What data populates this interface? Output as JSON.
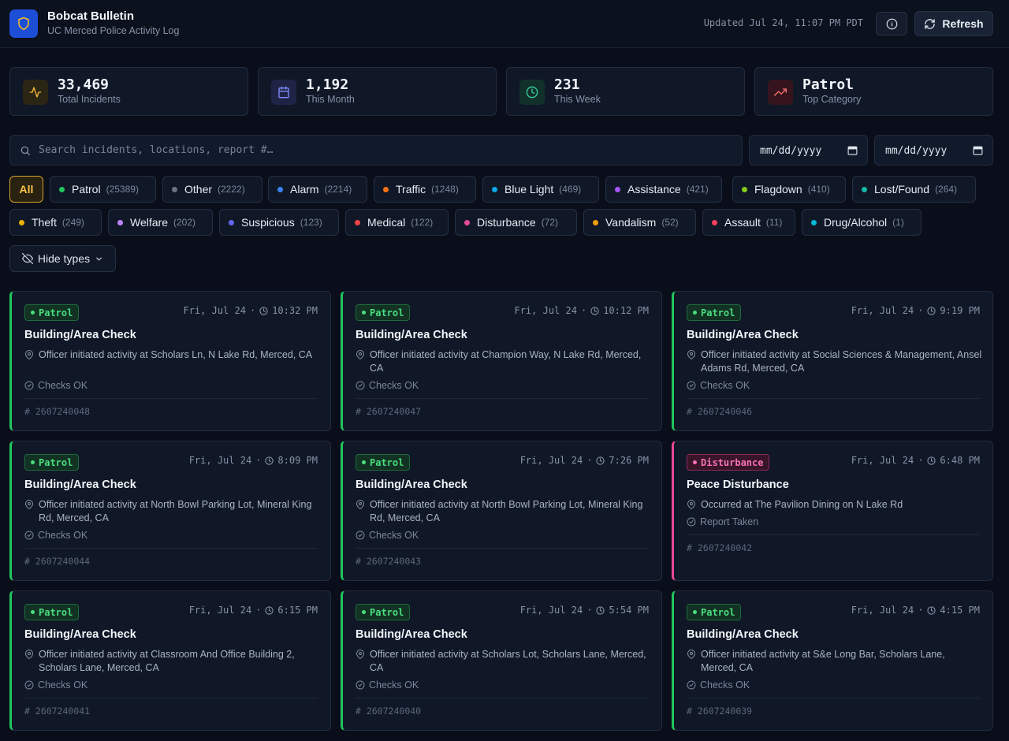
{
  "header": {
    "title": "Bobcat Bulletin",
    "subtitle": "UC Merced Police Activity Log",
    "updated": "Updated Jul 24, 11:07 PM PDT",
    "refresh_label": "Refresh"
  },
  "stats": [
    {
      "value": "33,469",
      "label": "Total Incidents",
      "icon": "activity-icon"
    },
    {
      "value": "1,192",
      "label": "This Month",
      "icon": "calendar-icon"
    },
    {
      "value": "231",
      "label": "This Week",
      "icon": "clock-icon"
    },
    {
      "value": "Patrol",
      "label": "Top Category",
      "icon": "trending-up-icon"
    }
  ],
  "search": {
    "placeholder": "Search incidents, locations, report #…"
  },
  "date_from": "mm/dd/yyyy",
  "date_to": "mm/dd/yyyy",
  "filters": {
    "all_label": "All",
    "chips": [
      {
        "label": "Patrol",
        "count": "(25389)",
        "color": "#22c55e"
      },
      {
        "label": "Other",
        "count": "(2222)",
        "color": "#6b7280"
      },
      {
        "label": "Alarm",
        "count": "(2214)",
        "color": "#3b82f6"
      },
      {
        "label": "Traffic",
        "count": "(1248)",
        "color": "#f97316"
      },
      {
        "label": "Blue Light",
        "count": "(469)",
        "color": "#0ea5e9"
      },
      {
        "label": "Assistance",
        "count": "(421)",
        "color": "#a855f7"
      },
      {
        "label": "Flagdown",
        "count": "(410)",
        "color": "#84cc16"
      },
      {
        "label": "Lost/Found",
        "count": "(264)",
        "color": "#14b8a6"
      },
      {
        "label": "Theft",
        "count": "(249)",
        "color": "#eab308"
      },
      {
        "label": "Welfare",
        "count": "(202)",
        "color": "#c084fc"
      },
      {
        "label": "Suspicious",
        "count": "(123)",
        "color": "#6366f1"
      },
      {
        "label": "Medical",
        "count": "(122)",
        "color": "#ef4444"
      },
      {
        "label": "Disturbance",
        "count": "(72)",
        "color": "#ec4899"
      },
      {
        "label": "Vandalism",
        "count": "(52)",
        "color": "#f59e0b"
      },
      {
        "label": "Assault",
        "count": "(11)",
        "color": "#f43f5e"
      },
      {
        "label": "Drug/Alcohol",
        "count": "(1)",
        "color": "#06b6d4"
      }
    ],
    "hide_label": "Hide types"
  },
  "incidents": [
    {
      "category": "Patrol",
      "date": "Fri, Jul 24",
      "time": "10:32 PM",
      "title": "Building/Area Check",
      "location": "Officer initiated activity at Scholars Ln, N Lake Rd, Merced, CA",
      "status": "Checks OK",
      "number": "2607240048"
    },
    {
      "category": "Patrol",
      "date": "Fri, Jul 24",
      "time": "10:12 PM",
      "title": "Building/Area Check",
      "location": "Officer initiated activity at Champion Way, N Lake Rd, Merced, CA",
      "status": "Checks OK",
      "number": "2607240047"
    },
    {
      "category": "Patrol",
      "date": "Fri, Jul 24",
      "time": "9:19 PM",
      "title": "Building/Area Check",
      "location": "Officer initiated activity at Social Sciences & Management, Ansel Adams Rd, Merced, CA",
      "status": "Checks OK",
      "number": "2607240046"
    },
    {
      "category": "Patrol",
      "date": "Fri, Jul 24",
      "time": "8:09 PM",
      "title": "Building/Area Check",
      "location": "Officer initiated activity at North Bowl Parking Lot, Mineral King Rd, Merced, CA",
      "status": "Checks OK",
      "number": "2607240044"
    },
    {
      "category": "Patrol",
      "date": "Fri, Jul 24",
      "time": "7:26 PM",
      "title": "Building/Area Check",
      "location": "Officer initiated activity at North Bowl Parking Lot, Mineral King Rd, Merced, CA",
      "status": "Checks OK",
      "number": "2607240043"
    },
    {
      "category": "Disturbance",
      "date": "Fri, Jul 24",
      "time": "6:48 PM",
      "title": "Peace Disturbance",
      "location": "Occurred at The Pavilion Dining on N Lake Rd",
      "status": "Report Taken",
      "number": "2607240042"
    },
    {
      "category": "Patrol",
      "date": "Fri, Jul 24",
      "time": "6:15 PM",
      "title": "Building/Area Check",
      "location": "Officer initiated activity at Classroom And Office Building 2, Scholars Lane, Merced, CA",
      "status": "Checks OK",
      "number": "2607240041"
    },
    {
      "category": "Patrol",
      "date": "Fri, Jul 24",
      "time": "5:54 PM",
      "title": "Building/Area Check",
      "location": "Officer initiated activity at Scholars Lot, Scholars Lane, Merced, CA",
      "status": "Checks OK",
      "number": "2607240040"
    },
    {
      "category": "Patrol",
      "date": "Fri, Jul 24",
      "time": "4:15 PM",
      "title": "Building/Area Check",
      "location": "Officer initiated activity at S&e Long Bar, Scholars Lane, Merced, CA",
      "status": "Checks OK",
      "number": "2607240039"
    }
  ]
}
